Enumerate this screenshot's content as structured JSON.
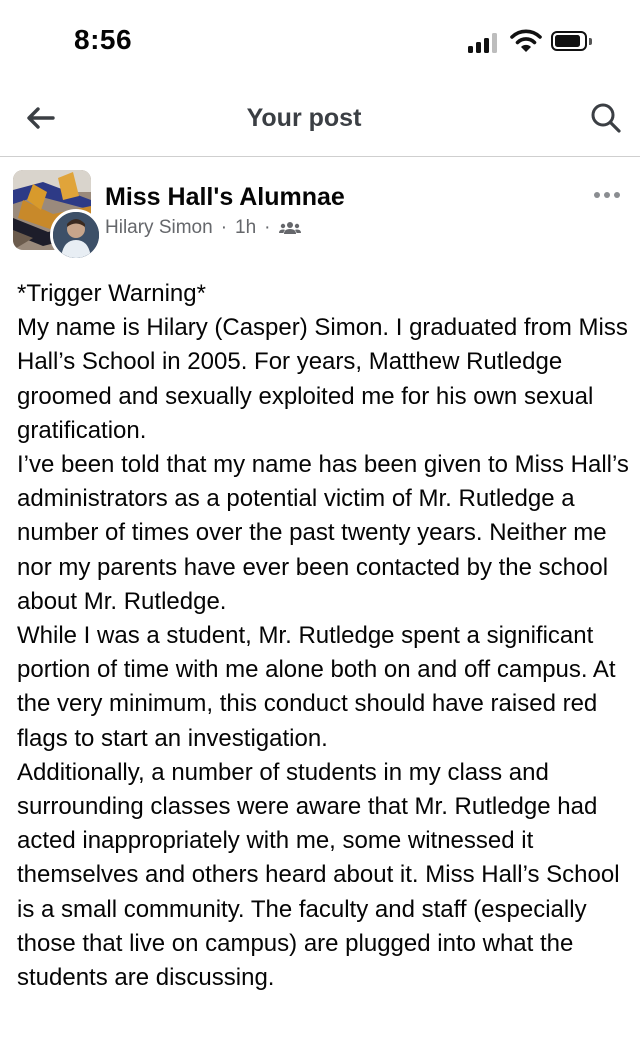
{
  "status_bar": {
    "time": "8:56"
  },
  "nav": {
    "title": "Your post"
  },
  "post": {
    "group_name": "Miss Hall's Alumnae",
    "author": "Hilary Simon",
    "time_ago": "1h",
    "separator": "·",
    "audience_icon": "group-members-icon",
    "paragraphs": [
      "*Trigger Warning*",
      "My name is Hilary (Casper) Simon. I graduated from Miss Hall’s School in 2005. For years, Matthew Rutledge groomed and sexually exploited me for his own sexual gratification.",
      "I’ve been told that my name has been given to Miss Hall’s administrators as a potential victim of Mr. Rutledge a number of times over the past twenty years. Neither me nor my parents have ever been contacted by the school about Mr. Rutledge.",
      "While I was a student, Mr. Rutledge spent a significant portion of time with me alone both on and off campus. At the very minimum, this conduct should have raised red flags to start an investigation.",
      "Additionally, a number of students in my class and surrounding classes were aware that Mr. Rutledge had acted inappropriately with me, some witnessed it themselves and others heard about it. Miss Hall’s School is a small community. The faculty and staff (especially those that live on campus) are plugged into what the students are discussing."
    ]
  },
  "colors": {
    "text": "#050505",
    "secondary": "#65676b",
    "divider": "#cfcfcf",
    "icon": "#3b3f44"
  }
}
